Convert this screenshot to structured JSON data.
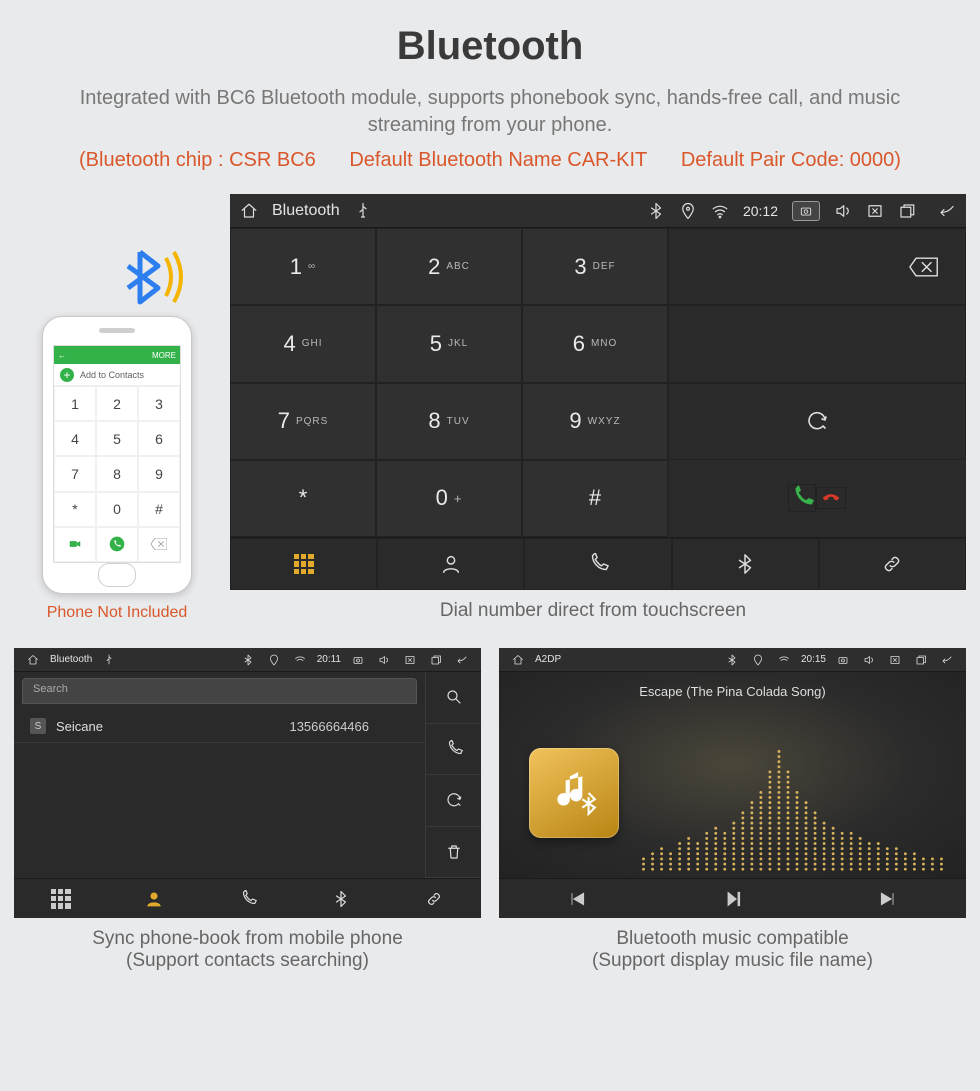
{
  "header": {
    "title": "Bluetooth",
    "subtitle": "Integrated with BC6 Bluetooth module, supports phonebook sync, hands-free call, and music streaming from your phone.",
    "tech_chip": "(Bluetooth chip : CSR BC6",
    "tech_name": "Default Bluetooth Name CAR-KIT",
    "tech_pair": "Default Pair Code: 0000)"
  },
  "phone": {
    "top_left": "←",
    "top_right": "MORE",
    "add_label": "Add to Contacts",
    "keys": [
      "1",
      "2",
      "3",
      "4",
      "5",
      "6",
      "7",
      "8",
      "9",
      "*",
      "0",
      "#"
    ],
    "not_included": "Phone Not Included"
  },
  "dialer": {
    "status": {
      "title": "Bluetooth",
      "time": "20:12"
    },
    "keys": [
      {
        "d": "1",
        "s": "∞"
      },
      {
        "d": "2",
        "s": "ABC"
      },
      {
        "d": "3",
        "s": "DEF"
      },
      {
        "d": "4",
        "s": "GHI"
      },
      {
        "d": "5",
        "s": "JKL"
      },
      {
        "d": "6",
        "s": "MNO"
      },
      {
        "d": "7",
        "s": "PQRS"
      },
      {
        "d": "8",
        "s": "TUV"
      },
      {
        "d": "9",
        "s": "WXYZ"
      },
      {
        "d": "*",
        "s": ""
      },
      {
        "d": "0",
        "s": "+"
      },
      {
        "d": "#",
        "s": ""
      }
    ],
    "caption": "Dial number direct from touchscreen"
  },
  "phonebook": {
    "status": {
      "title": "Bluetooth",
      "time": "20:11"
    },
    "search_placeholder": "Search",
    "contact": {
      "tag": "S",
      "name": "Seicane",
      "number": "13566664466"
    },
    "caption_l1": "Sync phone-book from mobile phone",
    "caption_l2": "(Support contacts searching)"
  },
  "music": {
    "status": {
      "title": "A2DP",
      "time": "20:15"
    },
    "song": "Escape (The Pina Colada Song)",
    "caption_l1": "Bluetooth music compatible",
    "caption_l2": "(Support display music file name)"
  }
}
